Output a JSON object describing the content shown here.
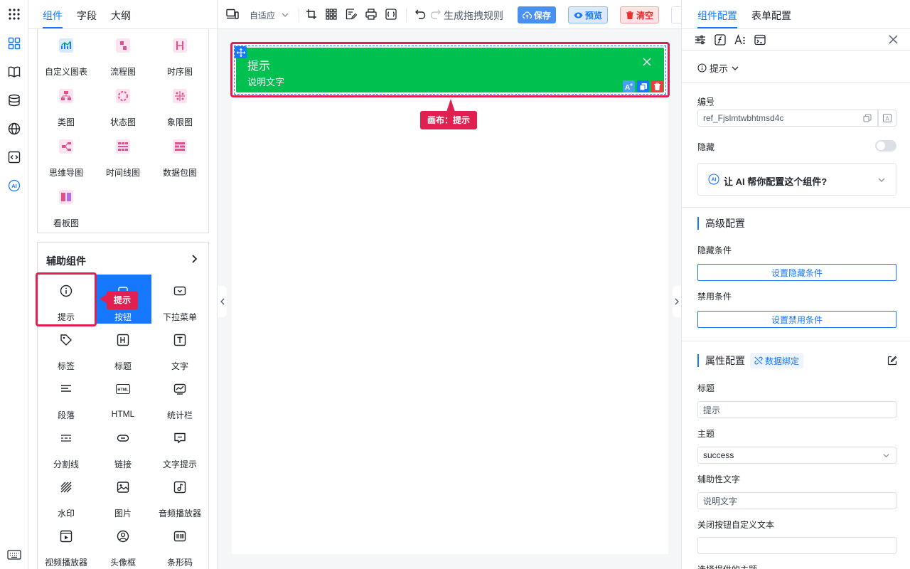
{
  "left_tabs": [
    "组件",
    "字段",
    "大纲"
  ],
  "chart_items": [
    "自定义图表",
    "流程图",
    "时序图",
    "类图",
    "状态图",
    "象限图",
    "思维导图",
    "时间线图",
    "数据包图",
    "看板图"
  ],
  "aux": {
    "title": "辅助组件",
    "items": [
      "提示",
      "按钮",
      "下拉菜单",
      "标签",
      "标题",
      "文字",
      "段落",
      "HTML",
      "统计栏",
      "分割线",
      "链接",
      "文字提示",
      "水印",
      "图片",
      "音频播放器",
      "视频播放器",
      "头像框",
      "条形码"
    ],
    "drag_tip": "提示"
  },
  "toolbar": {
    "adapt": "自适应",
    "generate": "生成拖拽规则",
    "save": "保存",
    "preview": "预览",
    "clear": "清空"
  },
  "canvas": {
    "alert_title": "提示",
    "alert_desc": "说明文字",
    "tooltip": "画布：提示"
  },
  "right": {
    "tabs": [
      "组件配置",
      "表单配置"
    ],
    "component": "提示",
    "id_label": "编号",
    "id_value": "ref_Fjslmtwbhtmsd4c",
    "hidden_label": "隐藏",
    "ai_text": "让 AI 帮你配置这个组件?",
    "advanced": "高级配置",
    "hide_cond": "隐藏条件",
    "hide_btn": "设置隐藏条件",
    "disable_cond": "禁用条件",
    "disable_btn": "设置禁用条件",
    "props": "属性配置",
    "bind": "数据绑定",
    "title_label": "标题",
    "title_value": "提示",
    "theme_label": "主题",
    "theme_value": "success",
    "desc_label": "辅助性文字",
    "desc_value": "说明文字",
    "close_label": "关闭按钮自定义文本",
    "close_value": "",
    "more_label": "选择提供的主题"
  },
  "colors": {
    "primary": "#1677ff",
    "success": "#00c050",
    "danger": "#e02050"
  }
}
